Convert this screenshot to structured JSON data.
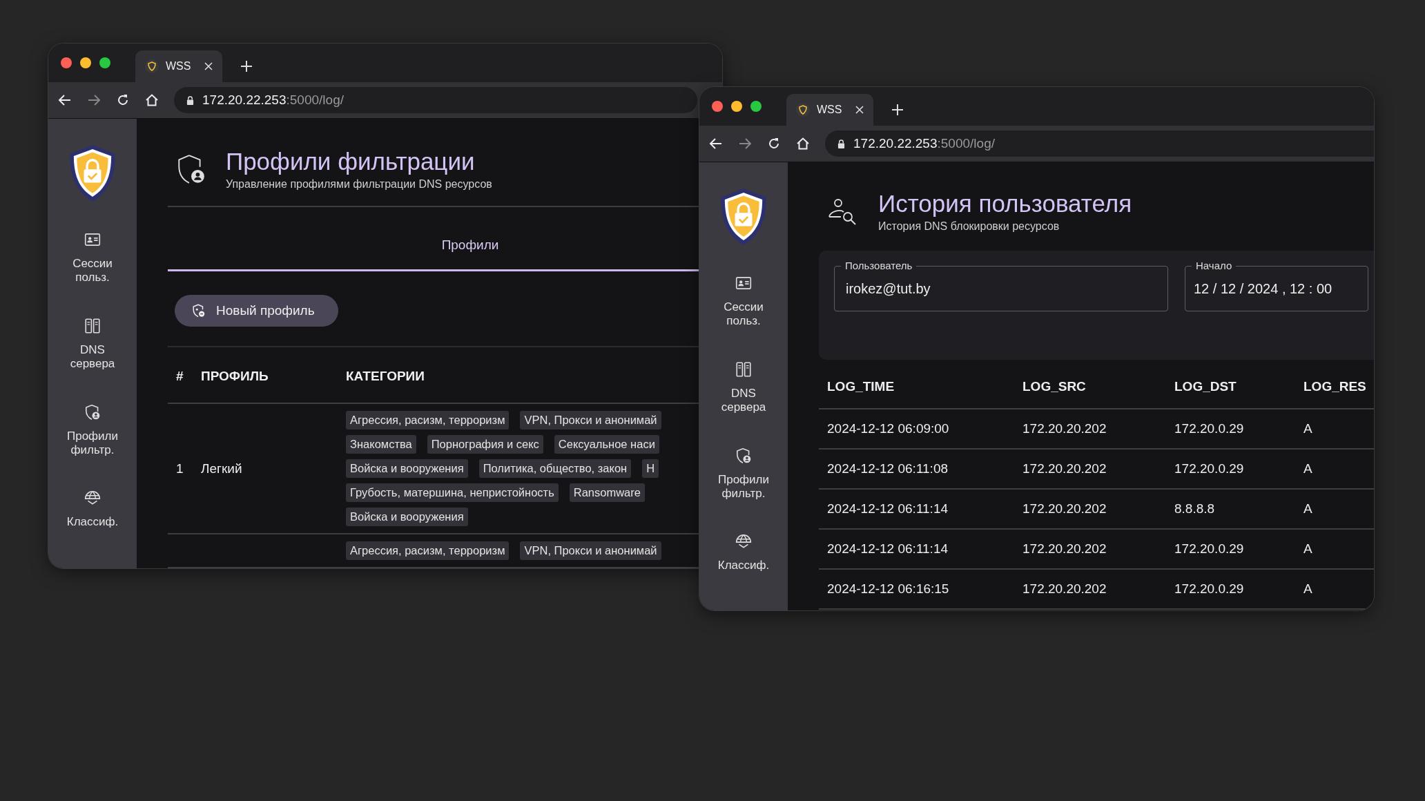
{
  "windows": [
    {
      "kind": "profiles",
      "tab_title": "WSS",
      "url_host": "172.20.22.253",
      "url_rest": ":5000/log/",
      "sidebar": [
        {
          "kind": "sessions",
          "label": "Сессии польз."
        },
        {
          "kind": "dns",
          "label": "DNS сервера"
        },
        {
          "kind": "profiles",
          "label": "Профили фильтр."
        },
        {
          "kind": "classify",
          "label": "Классиф."
        }
      ],
      "page": {
        "title": "Профили фильтрации",
        "subtitle": "Управление профилями фильтрации DNS ресурсов",
        "tabs": [
          {
            "label": "Профили",
            "selected": true
          }
        ],
        "new_button": "Новый профиль",
        "columns": [
          "#",
          "ПРОФИЛЬ",
          "КАТЕГОРИИ"
        ],
        "rows": [
          {
            "number": "1",
            "name": "Легкий",
            "category_lines": [
              [
                "Агрессия, расизм, терроризм",
                "VPN, Прокси и анонимай"
              ],
              [
                "Знакомства",
                "Порнография и секс",
                "Сексуальное наси"
              ],
              [
                "Войска и вооружения",
                "Политика, общество, закон",
                "Н"
              ],
              [
                "Грубость, матершина, непристойность",
                "Ransomware"
              ],
              [
                "Войска и вооружения"
              ]
            ]
          },
          {
            "category_lines": [
              [
                "Агрессия, расизм, терроризм",
                "VPN, Прокси и анонимай"
              ]
            ]
          }
        ]
      }
    },
    {
      "kind": "history",
      "tab_title": "WSS",
      "url_host": "172.20.22.253",
      "url_rest": ":5000/log/",
      "sidebar": [
        {
          "kind": "sessions",
          "label": "Сессии польз."
        },
        {
          "kind": "dns",
          "label": "DNS сервера"
        },
        {
          "kind": "profiles",
          "label": "Профили фильтр."
        },
        {
          "kind": "classify",
          "label": "Классиф."
        }
      ],
      "page": {
        "title": "История пользователя",
        "subtitle": "История DNS блокировки ресурсов",
        "fields": [
          {
            "label": "Пользователь",
            "value": "irokez@tut.by"
          },
          {
            "label": "Начало",
            "value": "12 / 12 / 2024 , 12 : 00"
          }
        ],
        "columns": [
          "LOG_TIME",
          "LOG_SRC",
          "LOG_DST",
          "LOG_RES"
        ],
        "rows": [
          [
            "2024-12-12 06:09:00",
            "172.20.20.202",
            "172.20.0.29",
            "A"
          ],
          [
            "2024-12-12 06:11:08",
            "172.20.20.202",
            "172.20.0.29",
            "A"
          ],
          [
            "2024-12-12 06:11:14",
            "172.20.20.202",
            "8.8.8.8",
            "A"
          ],
          [
            "2024-12-12 06:11:14",
            "172.20.20.202",
            "172.20.0.29",
            "A"
          ],
          [
            "2024-12-12 06:16:15",
            "172.20.20.202",
            "172.20.0.29",
            "A"
          ]
        ]
      }
    }
  ]
}
